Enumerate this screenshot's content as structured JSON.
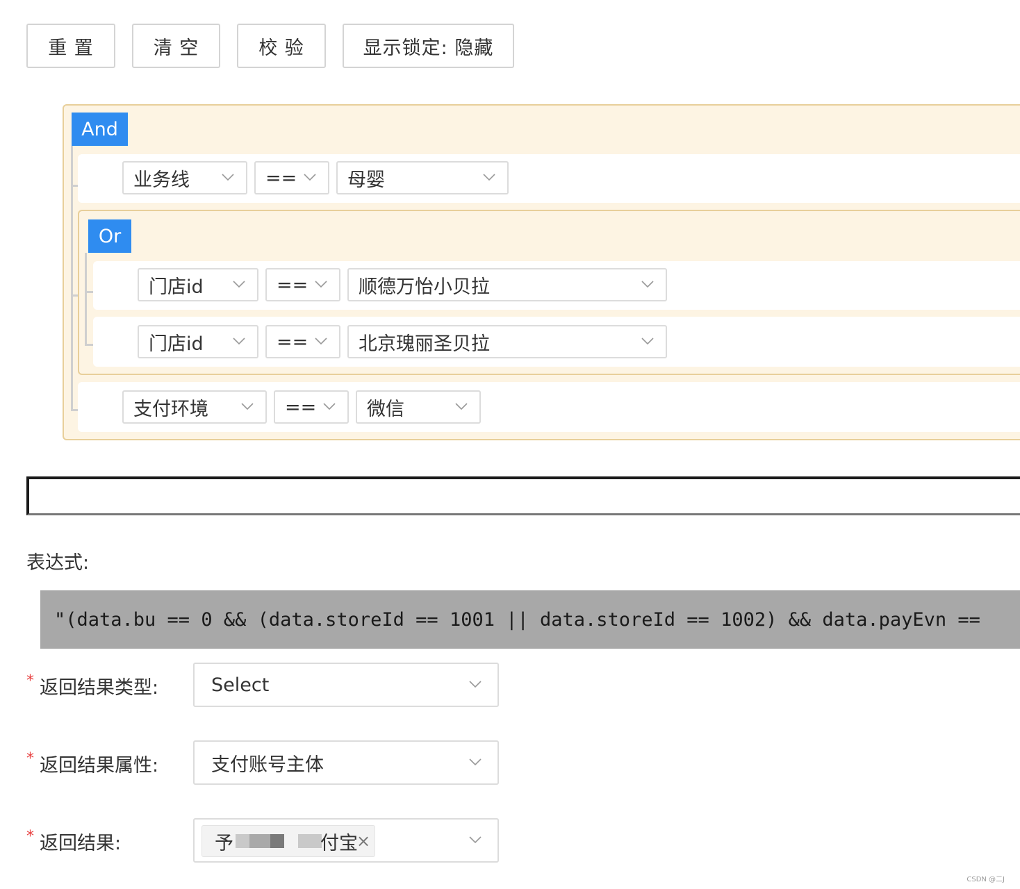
{
  "toolbar": {
    "reset_label": "重 置",
    "clear_label": "清 空",
    "validate_label": "校 验",
    "lock_label": "显示锁定: 隐藏"
  },
  "root_group": {
    "operator": "And",
    "rule1": {
      "field": "业务线",
      "op": "==",
      "value": "母婴"
    },
    "sub_group": {
      "operator": "Or",
      "rule1": {
        "field": "门店id",
        "op": "==",
        "value": "顺德万怡小贝拉"
      },
      "rule2": {
        "field": "门店id",
        "op": "==",
        "value": "北京瑰丽圣贝拉"
      }
    },
    "rule3": {
      "field": "支付环境",
      "op": "==",
      "value": "微信"
    }
  },
  "expression": {
    "label": "表达式:",
    "code": "\"(data.bu == 0 && (data.storeId == 1001 || data.storeId == 1002) && data.payEvn =="
  },
  "form": {
    "result_type": {
      "label": "返回结果类型:",
      "value": "Select"
    },
    "result_attr": {
      "label": "返回结果属性:",
      "value": "支付账号主体"
    },
    "result": {
      "label": "返回结果:",
      "chip_prefix": "予",
      "chip_suffix": "付宝",
      "chip_close": "×"
    },
    "required_mark": "*"
  },
  "watermark": "CSDN @二J",
  "colors": {
    "tag_blue": "#2f8cf0",
    "group_bg": "#fdf4e3",
    "group_border": "#e8cf9a",
    "code_bg": "#a8a8a8",
    "required": "#e84141"
  }
}
